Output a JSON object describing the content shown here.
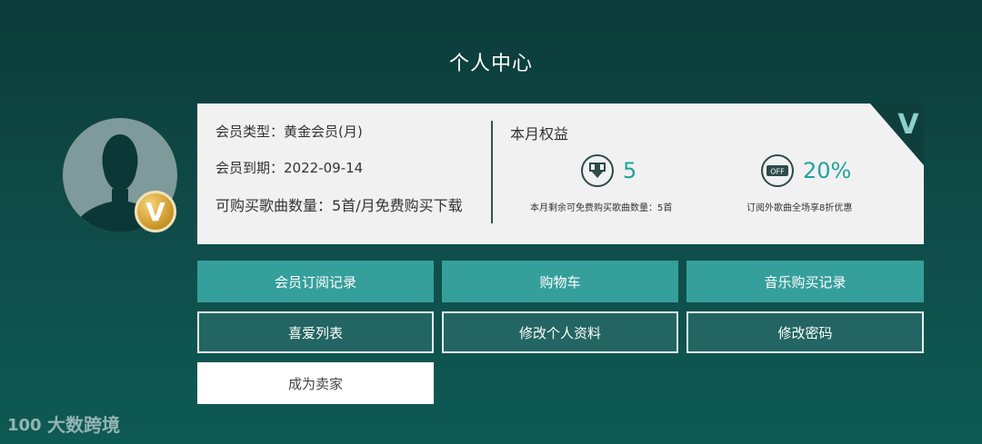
{
  "page": {
    "title": "个人中心"
  },
  "profile": {
    "vip_letter": "V"
  },
  "membership": {
    "type_label": "会员类型：",
    "type_value": "黄金会员(月)",
    "expire_label": "会员到期：",
    "expire_value": "2022-09-14",
    "quota_label": "可购买歌曲数量：",
    "quota_value": "5首/月免费购买下载"
  },
  "benefits": {
    "title": "本月权益",
    "items": [
      {
        "icon": "download-icon",
        "value": "5",
        "desc": "本月剩余可免费购买歌曲数量：5首"
      },
      {
        "icon": "off-icon",
        "icon_text": "OFF",
        "value": "20%",
        "desc": "订阅外歌曲全场享8折优惠"
      }
    ],
    "corner_letter": "V"
  },
  "actions": {
    "subscription_records": "会员订阅记录",
    "cart": "购物车",
    "music_purchase_records": "音乐购买记录",
    "favorites": "喜爱列表",
    "edit_profile": "修改个人资料",
    "change_password": "修改密码",
    "become_seller": "成为卖家"
  },
  "watermark": {
    "text": "大数跨境",
    "logo": "100"
  },
  "colors": {
    "accent_teal": "#359f9b",
    "number_teal": "#22a39a",
    "gold": "#d3a033",
    "card_bg": "#f1f1f1"
  }
}
